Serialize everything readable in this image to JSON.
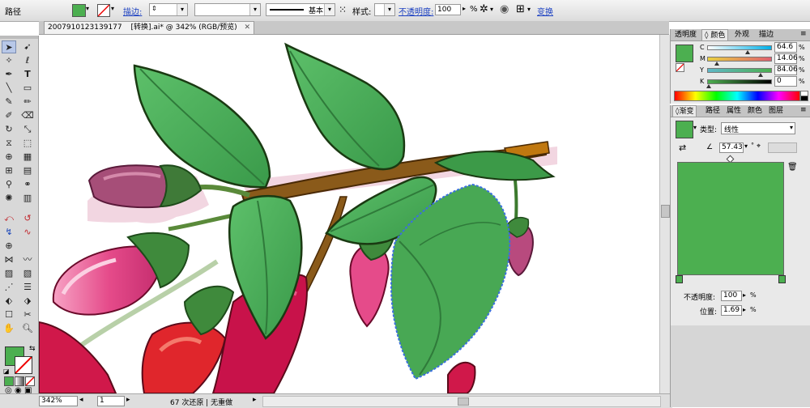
{
  "control_bar": {
    "object_type": "路径",
    "fill_color": "#4caf50",
    "stroke_label": "描边:",
    "stroke_profile": "基本",
    "style_label": "样式:",
    "opacity_label": "不透明度:",
    "opacity_value": "100",
    "percent": "%",
    "transform_label": "变换"
  },
  "document_tab": {
    "title": "2007910123139177",
    "tab_label": "[转换].ai* @ 342% (RGB/预览)",
    "close_glyph": "✕"
  },
  "status_bar": {
    "zoom": "342%",
    "artboard": "1",
    "undo_info": "67 次还原 | 无重做"
  },
  "color_panel": {
    "tabs": [
      "透明度",
      "颜色",
      "外观",
      "描边"
    ],
    "active_tab": "颜色",
    "current_color": "#4caf50",
    "channels": [
      {
        "name": "C",
        "value": "64.6",
        "pct": 0.646
      },
      {
        "name": "M",
        "value": "14.06",
        "pct": 0.1406
      },
      {
        "name": "Y",
        "value": "84.06",
        "pct": 0.8406
      },
      {
        "name": "K",
        "value": "0",
        "pct": 0.0
      }
    ],
    "unit": "%"
  },
  "gradient_panel": {
    "tabs": [
      "渐变",
      "路径",
      "属性",
      "颜色",
      "图层"
    ],
    "active_tab": "渐变",
    "type_label": "类型:",
    "type_value": "线性",
    "angle_value": "57.43",
    "degree_symbol": "°",
    "swatch_color": "#4caf50",
    "opacity_label": "不透明度:",
    "opacity_value": "100",
    "location_label": "位置:",
    "location_value": "1.69",
    "unit": "%"
  },
  "colors": {
    "leaf": "#4caf5a",
    "leaf_dark": "#2e7d3a",
    "branch": "#7a4a10",
    "bud_pink": "#e0487a",
    "bud_purple": "#a24a72",
    "flower_red": "#d81b4a",
    "selection_blue": "#3a6fe0"
  }
}
